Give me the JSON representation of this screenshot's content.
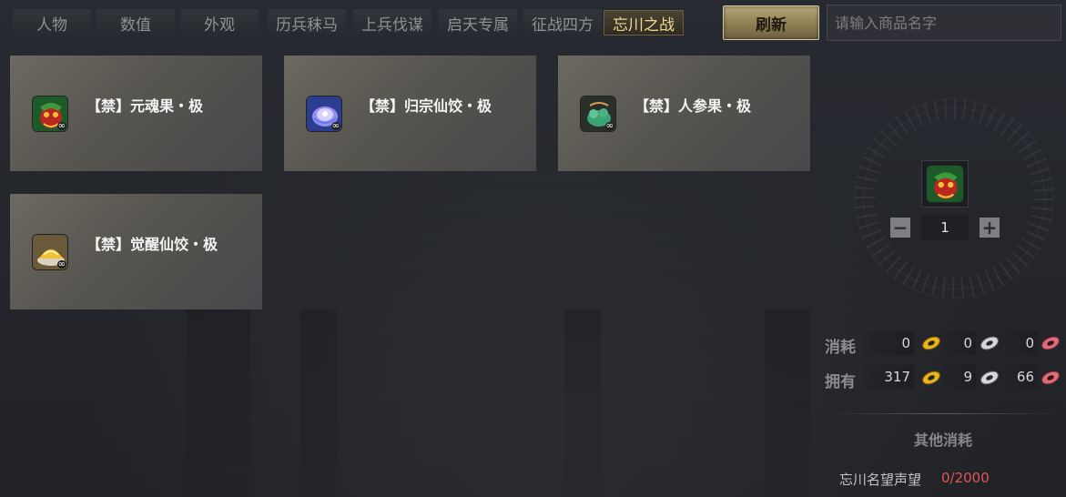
{
  "tabs": [
    {
      "label": "人物"
    },
    {
      "label": "数值"
    },
    {
      "label": "外观"
    },
    {
      "label": "历兵秣马"
    },
    {
      "label": "上兵伐谋"
    },
    {
      "label": "启天专属"
    },
    {
      "label": "征战四方"
    },
    {
      "label": "忘川之战",
      "active": true
    }
  ],
  "toolbar": {
    "refresh_label": "刷新"
  },
  "search": {
    "placeholder": "请输入商品名字",
    "value": ""
  },
  "items": [
    {
      "name": "【禁】元魂果・极",
      "icon": "red-dragon-fruit-icon",
      "badge": "∞"
    },
    {
      "name": "【禁】归宗仙饺・极",
      "icon": "blue-crystal-dumpling-icon",
      "badge": "∞"
    },
    {
      "name": "【禁】人参果・极",
      "icon": "jade-ginseng-fruit-icon",
      "badge": "∞"
    },
    {
      "name": "【禁】觉醒仙饺・极",
      "icon": "golden-dumpling-icon",
      "badge": "∞"
    }
  ],
  "purchase": {
    "selected_icon": "red-dragon-fruit-icon",
    "quantity": "1",
    "minus_label": "−",
    "plus_label": "+"
  },
  "currency": {
    "cost_label": "消耗",
    "own_label": "拥有",
    "cost": [
      "0",
      "0",
      "0"
    ],
    "own": [
      "317",
      "9",
      "66"
    ],
    "coin_icons": [
      "gold-coin-icon",
      "silver-coin-icon",
      "pink-coin-icon"
    ]
  },
  "other": {
    "title": "其他消耗",
    "reputation_label": "忘川名望声望",
    "reputation_value": "0/2000",
    "reputation_color": "#e0565b"
  },
  "colors": {
    "accent_gold": "#f0d890",
    "button_gold": "#b8a77c",
    "card_bg": "#5f5d56"
  }
}
